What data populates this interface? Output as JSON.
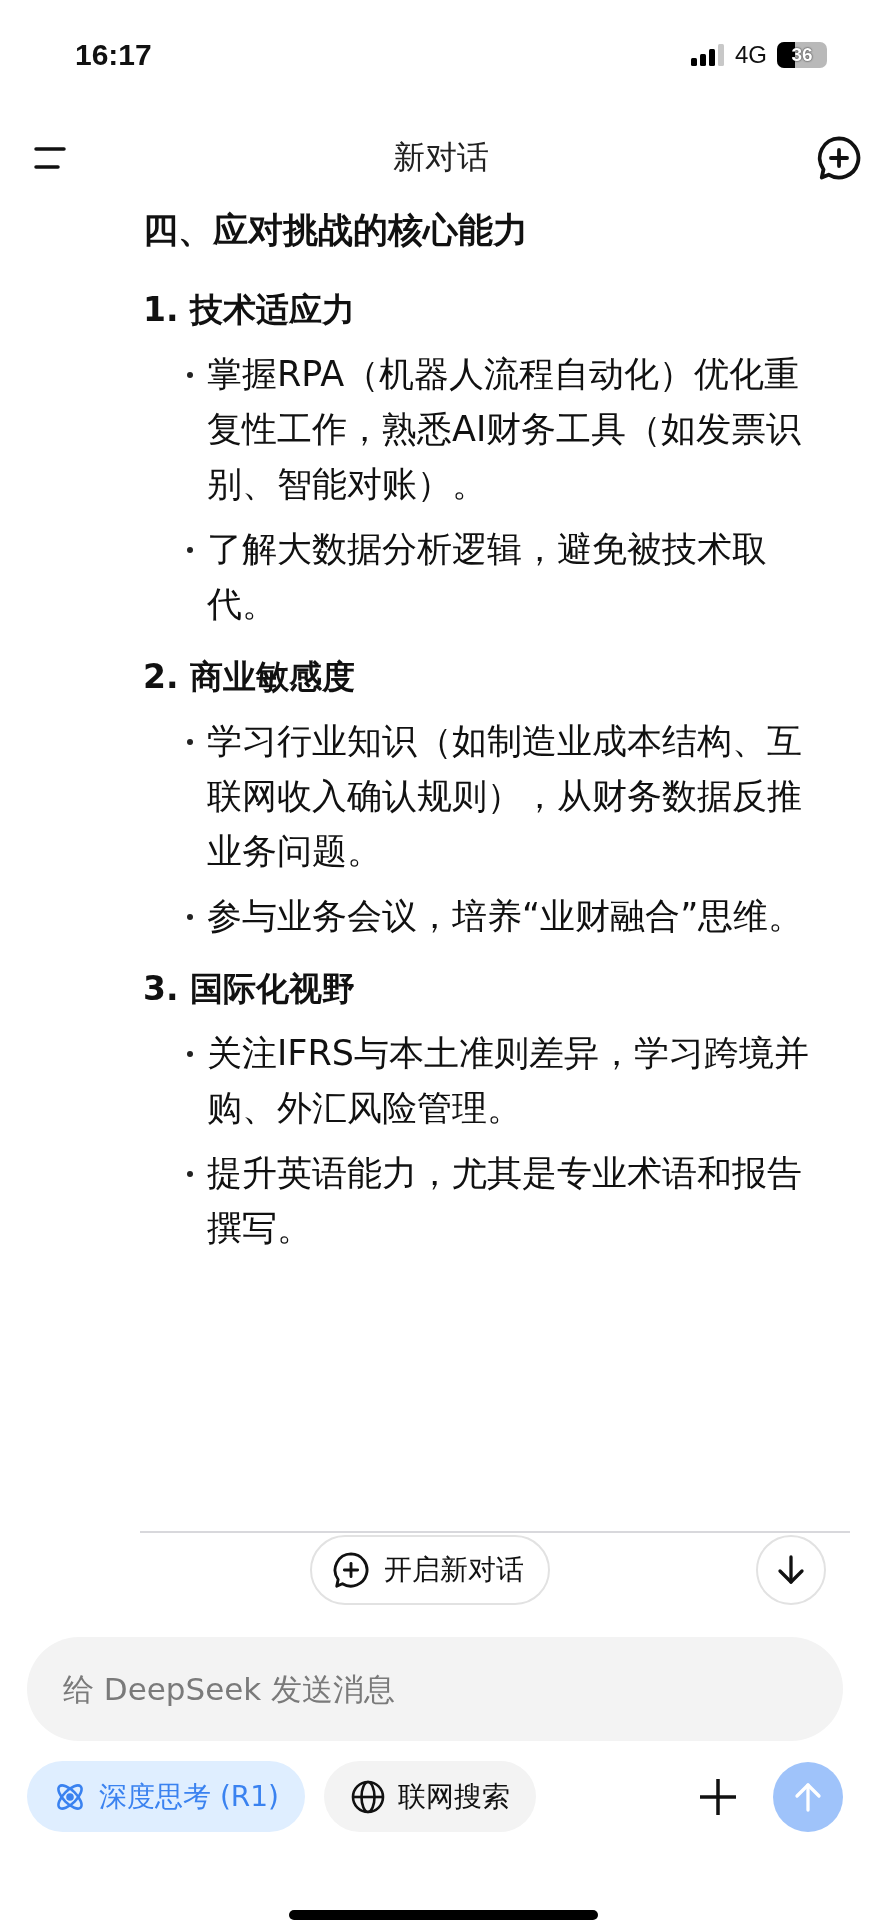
{
  "status_bar": {
    "time": "16:17",
    "network": "4G",
    "battery": "36"
  },
  "header": {
    "title": "新对话"
  },
  "content": {
    "heading": "四、应对挑战的核心能力",
    "sections": [
      {
        "title": "1. 技术适应力",
        "bullets": [
          "掌握RPA（机器人流程自动化）优化重复性工作，熟悉AI财务工具（如发票识别、智能对账）。",
          "了解大数据分析逻辑，避免被技术取代。"
        ]
      },
      {
        "title": "2. 商业敏感度",
        "bullets": [
          "学习行业知识（如制造业成本结构、互联网收入确认规则），从财务数据反推业务问题。",
          "参与业务会议，培养“业财融合”思维。"
        ]
      },
      {
        "title": "3. 国际化视野",
        "bullets": [
          "关注IFRS与本土准则差异，学习跨境并购、外汇风险管理。",
          "提升英语能力，尤其是专业术语和报告撰写。"
        ]
      }
    ]
  },
  "new_chat_button": {
    "label": "开启新对话"
  },
  "composer": {
    "placeholder": "给 DeepSeek 发送消息",
    "toggles": [
      {
        "kind": "deep_think",
        "label": "深度思考 (R1)",
        "selected": true
      },
      {
        "kind": "web_search",
        "label": "联网搜索",
        "selected": false
      }
    ],
    "send": {
      "disabled": true
    }
  }
}
